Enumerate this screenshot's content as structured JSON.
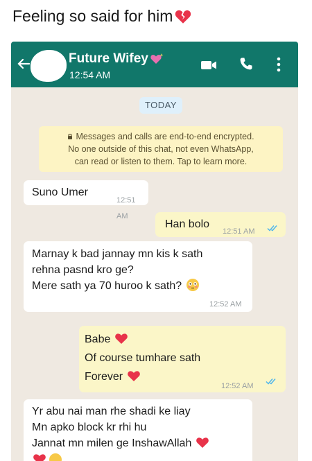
{
  "caption": {
    "text": "Feeling so said for him",
    "emoji": "broken-heart-icon"
  },
  "header": {
    "contact_name": "Future Wifey",
    "last_seen": "12:54 AM",
    "bg_color": "#11776a",
    "icons": [
      "back-arrow-icon",
      "video-call-icon",
      "phone-icon",
      "kebab-menu-icon"
    ]
  },
  "day_chip": "TODAY",
  "encryption_notice": {
    "line1": "Messages and calls are end-to-end encrypted.",
    "line2": "No one outside of this chat, not even WhatsApp,",
    "line3": "can read or listen to them. Tap to learn more."
  },
  "messages": [
    {
      "direction": "in",
      "lines": [
        "Suno Umer"
      ],
      "time": "12:51 AM"
    },
    {
      "direction": "out",
      "lines": [
        "Han bolo"
      ],
      "time": "12:51 AM",
      "read": true
    },
    {
      "direction": "in",
      "lines": [
        "Marnay k bad jannay mn kis k sath",
        "rehna pasnd kro ge?",
        "Mere sath ya 70 huroo k sath?"
      ],
      "time": "12:52 AM"
    },
    {
      "direction": "out",
      "lines": [
        "Babe",
        "Of course tumhare sath",
        "Forever"
      ],
      "time": "12:52 AM",
      "read": true
    },
    {
      "direction": "in",
      "lines": [
        "Yr abu nai man rhe shadi ke liay",
        "Mn apko block kr rhi hu",
        "Jannat mn milen ge InshawAllah"
      ]
    }
  ]
}
